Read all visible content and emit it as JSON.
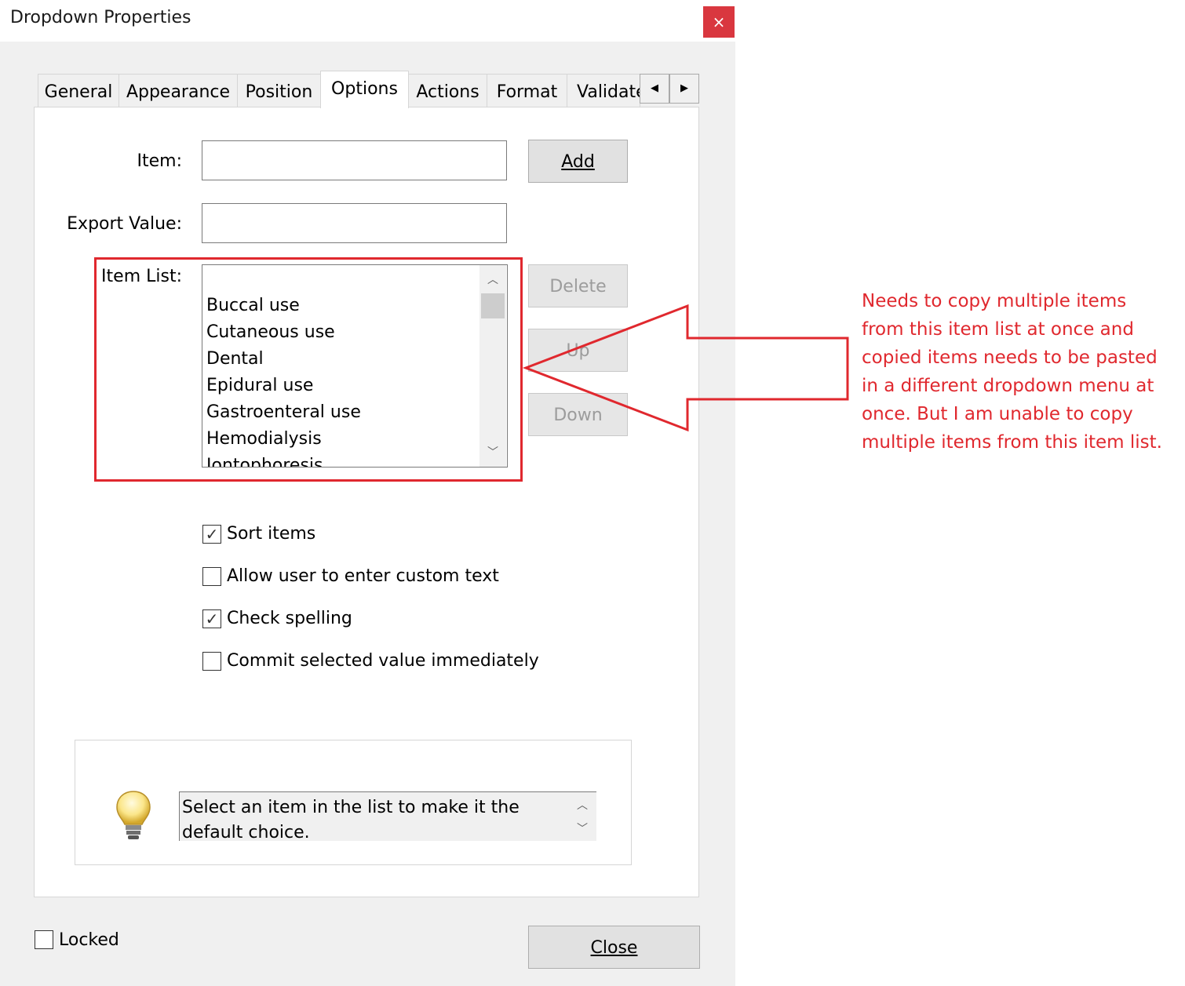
{
  "window": {
    "title": "Dropdown Properties",
    "close_glyph": "×"
  },
  "tabs": [
    {
      "label": "General"
    },
    {
      "label": "Appearance"
    },
    {
      "label": "Position"
    },
    {
      "label": "Options",
      "active": true
    },
    {
      "label": "Actions"
    },
    {
      "label": "Format"
    },
    {
      "label": "Validate"
    }
  ],
  "options": {
    "item_label": "Item:",
    "item_value": "",
    "export_label": "Export Value:",
    "export_value": "",
    "add_label": "Add",
    "item_list_label": "Item List:",
    "item_list": [
      "",
      "Buccal use",
      "Cutaneous use",
      "Dental",
      "Epidural use",
      "Gastroenteral use",
      "Hemodialysis",
      "Iontophoresis"
    ],
    "delete_label": "Delete",
    "up_label": "Up",
    "down_label": "Down",
    "checkboxes": [
      {
        "label": "Sort items",
        "checked": true
      },
      {
        "label": "Allow user to enter custom text",
        "checked": false
      },
      {
        "label": "Check spelling",
        "checked": true
      },
      {
        "label": "Commit selected value immediately",
        "checked": false
      }
    ],
    "tip_text": "Select an item in the list to make it the default choice."
  },
  "footer": {
    "locked_label": "Locked",
    "locked_checked": false,
    "close_label": "Close"
  },
  "annotation": {
    "lines": [
      "Needs to copy multiple items",
      "from this item list at once and",
      "copied items needs to be pasted",
      "in a different dropdown menu at",
      "once. But I am unable to copy",
      "multiple items from this item list."
    ],
    "color": "#e0282e"
  },
  "icons": {
    "tab_scroll_left": "arrow-left-icon",
    "tab_scroll_right": "arrow-right-icon",
    "scroll_up": "chevron-up-icon",
    "scroll_down": "chevron-down-icon",
    "tip": "lightbulb-icon",
    "check": "checkmark-icon"
  }
}
